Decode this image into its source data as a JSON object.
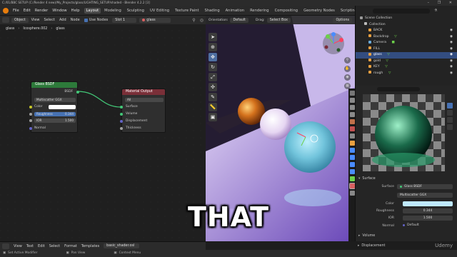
{
  "window": {
    "title": "C:/01/BBC SETUP (C:/Render 4 new)/My_Projects/glass/LIGHTING_SETUP/shaded - Blender 4.2.2 [3]",
    "controls": "– ❐ ✕"
  },
  "menu": [
    "File",
    "Edit",
    "Render",
    "Window",
    "Help"
  ],
  "workspaces": [
    "Layout",
    "Modeling",
    "Sculpting",
    "UV Editing",
    "Texture Paint",
    "Shading",
    "Animation",
    "Rendering",
    "Compositing",
    "Geometry Nodes",
    "Scripting"
  ],
  "active_workspace": "Layout",
  "scene": {
    "label": "Scene",
    "view_layer": "ViewLayer"
  },
  "node_editor": {
    "header": {
      "type": "Object",
      "menus": [
        "View",
        "Select",
        "Add",
        "Node"
      ],
      "use_nodes_label": "Use Nodes",
      "slot": "Slot 1",
      "material": "glass"
    },
    "breadcrumb": [
      "glass",
      "Icosphere.002",
      "glass"
    ],
    "bsdf_node": {
      "title": "Glass BSDF",
      "output_socket": "BSDF",
      "distribution": "Multiscatter GGX",
      "inputs": [
        {
          "label": "Color",
          "value": ""
        },
        {
          "label": "Roughness",
          "value": "0.344"
        },
        {
          "label": "IOR",
          "value": "1.500"
        },
        {
          "label": "Normal",
          "value": ""
        }
      ]
    },
    "output_node": {
      "title": "Material Output",
      "target": "All",
      "inputs": [
        "Surface",
        "Volume",
        "Displacement",
        "Thickness"
      ]
    }
  },
  "viewport": {
    "orientation_label": "Orientation:",
    "orientation": "Default",
    "drag_label": "Drag:",
    "drag": "Select Box",
    "options": "Options"
  },
  "outliner": {
    "search_placeholder": "",
    "root": "Scene Collection",
    "collection": "Collection",
    "items": [
      {
        "name": "BACK",
        "color": "#e8a040"
      },
      {
        "name": "Backdrop",
        "color": "#e8a040"
      },
      {
        "name": "Camera",
        "color": "#6aaad8"
      },
      {
        "name": "FILL",
        "color": "#e8a040"
      },
      {
        "name": "glass",
        "color": "#e8a040",
        "selected": true
      },
      {
        "name": "gold",
        "color": "#e8a040"
      },
      {
        "name": "KEY",
        "color": "#e8a040"
      },
      {
        "name": "rough",
        "color": "#e8a040"
      }
    ]
  },
  "properties": {
    "search_placeholder": "",
    "surface_panel": "Surface",
    "surface_label": "Surface",
    "surface_value": "Glass BSDF",
    "distribution": "Multiscatter GGX",
    "fields": [
      {
        "label": "Color",
        "value": ""
      },
      {
        "label": "Roughness",
        "value": "0.344"
      },
      {
        "label": "IOR",
        "value": "1.500"
      },
      {
        "label": "Normal",
        "value": "Default"
      }
    ],
    "volume_panel": "Volume",
    "displacement_panel": "Displacement"
  },
  "text_editor": {
    "menus": [
      "View",
      "Text",
      "Edit",
      "Select",
      "Format",
      "Templates"
    ],
    "file": "basic_shader.osl"
  },
  "status": {
    "left": "Set Active Modifier",
    "middle": "Pan View",
    "right": "Context Menu"
  },
  "subtitle": "THAT",
  "watermark": "Udemy"
}
